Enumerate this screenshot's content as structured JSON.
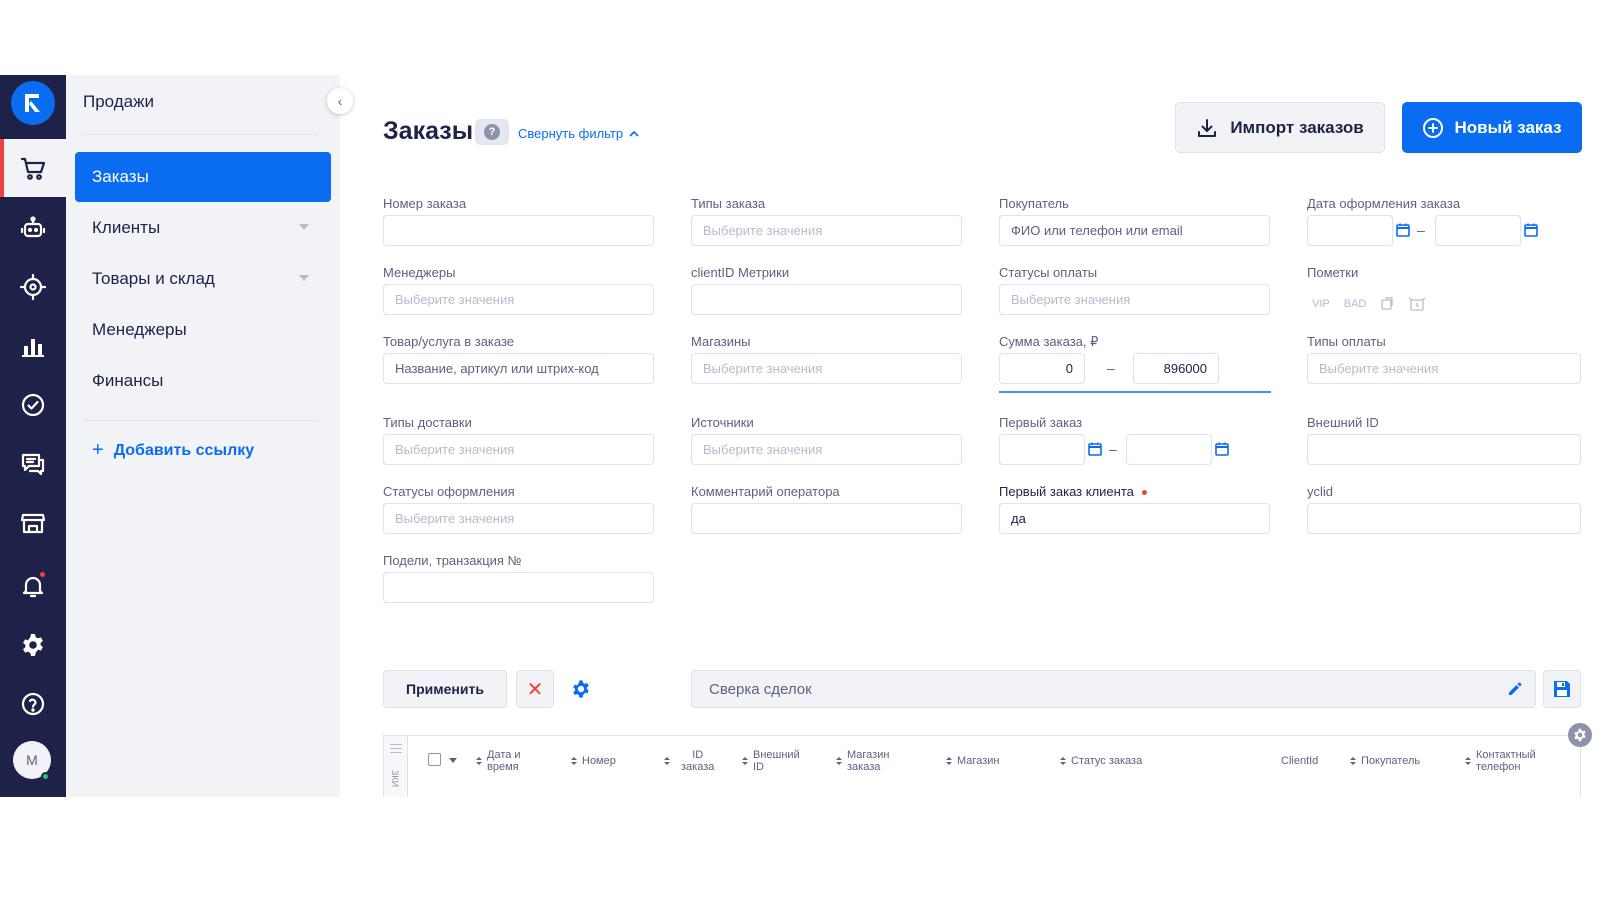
{
  "rail": {
    "items": [
      {
        "icon": "cart-icon",
        "active": true
      },
      {
        "icon": "robot-icon"
      },
      {
        "icon": "target-icon"
      },
      {
        "icon": "bar-chart-icon"
      },
      {
        "icon": "check-circle-icon"
      },
      {
        "icon": "chat-icon"
      },
      {
        "icon": "store-icon"
      },
      {
        "icon": "bell-icon"
      },
      {
        "icon": "gear-icon"
      },
      {
        "icon": "help-icon"
      }
    ],
    "avatar_initial": "M"
  },
  "sidebar": {
    "title": "Продажи",
    "items": [
      {
        "label": "Заказы",
        "active": true
      },
      {
        "label": "Клиенты",
        "has_submenu": true
      },
      {
        "label": "Товары и склад",
        "has_submenu": true
      },
      {
        "label": "Менеджеры"
      },
      {
        "label": "Финансы"
      }
    ],
    "add_link": "Добавить ссылку"
  },
  "header": {
    "title": "Заказы",
    "toggle_filter": "Свернуть фильтр",
    "import_button": "Импорт заказов",
    "new_button": "Новый заказ"
  },
  "filters": {
    "order_number": {
      "label": "Номер заказа",
      "value": ""
    },
    "order_types": {
      "label": "Типы заказа",
      "placeholder": "Выберите значения"
    },
    "buyer": {
      "label": "Покупатель",
      "placeholder": "ФИО или телефон или email"
    },
    "order_date": {
      "label": "Дата оформления заказа",
      "from": "",
      "to": "",
      "separator": "–"
    },
    "managers": {
      "label": "Менеджеры",
      "placeholder": "Выберите значения"
    },
    "client_id": {
      "label": "clientID Метрики",
      "value": ""
    },
    "payment_statuses": {
      "label": "Статусы оплаты",
      "placeholder": "Выберите значения"
    },
    "marks": {
      "label": "Пометки",
      "tags": [
        "VIP",
        "BAD"
      ]
    },
    "product": {
      "label": "Товар/услуга в заказе",
      "placeholder": "Название, артикул или штрих-код"
    },
    "shops": {
      "label": "Магазины",
      "placeholder": "Выберите значения"
    },
    "order_sum": {
      "label": "Сумма заказа, ₽",
      "from": "0",
      "to": "896000",
      "separator": "–"
    },
    "payment_types": {
      "label": "Типы оплаты",
      "placeholder": "Выберите значения"
    },
    "delivery_types": {
      "label": "Типы доставки",
      "placeholder": "Выберите значения"
    },
    "sources": {
      "label": "Источники",
      "placeholder": "Выберите значения"
    },
    "first_order": {
      "label": "Первый заказ",
      "from": "",
      "to": "",
      "separator": "–"
    },
    "external_id": {
      "label": "Внешний ID",
      "value": ""
    },
    "checkout_statuses": {
      "label": "Статусы оформления",
      "placeholder": "Выберите значения"
    },
    "operator_comment": {
      "label": "Комментарий оператора",
      "value": ""
    },
    "client_first_order": {
      "label": "Первый заказ клиента",
      "value": "да"
    },
    "yclid": {
      "label": "yclid",
      "value": ""
    },
    "podeli": {
      "label": "Подели, транзакция №",
      "value": ""
    }
  },
  "actions": {
    "apply": "Применить",
    "clear": "✕",
    "preset": "Сверка сделок"
  },
  "table": {
    "side_label": "ЗКИ",
    "columns": [
      {
        "line1": "Дата и",
        "line2": "время",
        "sortable": true
      },
      {
        "line1": "Номер",
        "line2": "",
        "sortable": true
      },
      {
        "line1": "ID",
        "line2": "заказа",
        "sortable": true
      },
      {
        "line1": "Внешний",
        "line2": "ID",
        "sortable": true
      },
      {
        "line1": "Магазин",
        "line2": "заказа",
        "sortable": true
      },
      {
        "line1": "Магазин",
        "line2": "",
        "sortable": true
      },
      {
        "line1": "Статус заказа",
        "line2": "",
        "sortable": true
      },
      {
        "line1": "ClientId",
        "line2": "",
        "sortable": false
      },
      {
        "line1": "Покупатель",
        "line2": "",
        "sortable": true
      },
      {
        "line1": "Контактный",
        "line2": "телефон",
        "sortable": true
      }
    ]
  },
  "colors": {
    "rail_bg": "#1e2248",
    "accent": "#0a6cf0",
    "danger": "#f0423c",
    "sidebar_bg": "#f2f3f7"
  }
}
